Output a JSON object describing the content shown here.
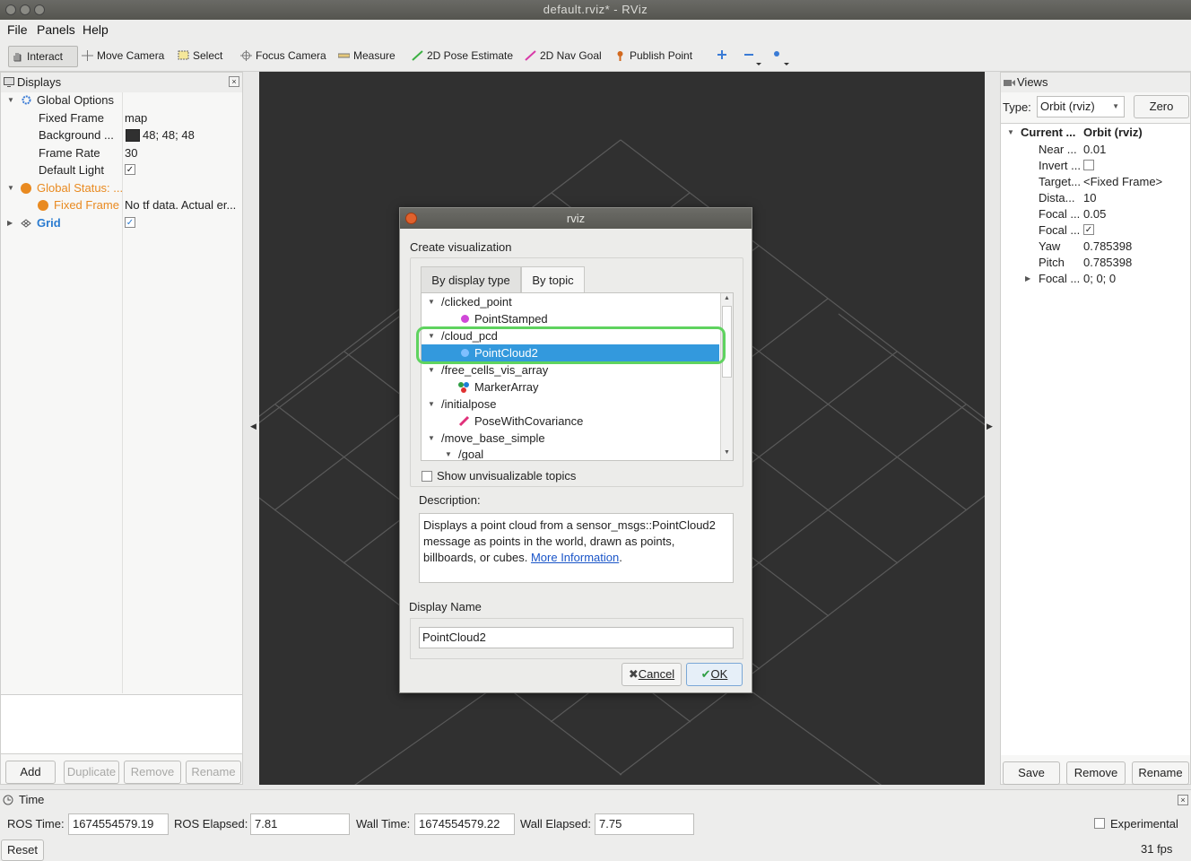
{
  "window": {
    "title": "default.rviz* - RViz"
  },
  "menu": {
    "file": "File",
    "panels": "Panels",
    "help": "Help"
  },
  "toolbar": {
    "interact": "Interact",
    "move_camera": "Move Camera",
    "select": "Select",
    "focus_camera": "Focus Camera",
    "measure": "Measure",
    "pose_estimate": "2D Pose Estimate",
    "nav_goal": "2D Nav Goal",
    "publish_point": "Publish Point"
  },
  "displays": {
    "title": "Displays",
    "global_options": "Global Options",
    "fixed_frame_label": "Fixed Frame",
    "fixed_frame_value": "map",
    "background_label": "Background ...",
    "background_value": "48; 48; 48",
    "frame_rate_label": "Frame Rate",
    "frame_rate_value": "30",
    "default_light_label": "Default Light",
    "global_status": "Global Status: ...",
    "fixed_frame_status_label": "Fixed Frame",
    "fixed_frame_status_value": "No tf data.  Actual er...",
    "grid_label": "Grid",
    "buttons": {
      "add": "Add",
      "duplicate": "Duplicate",
      "remove": "Remove",
      "rename": "Rename"
    }
  },
  "views": {
    "title": "Views",
    "type_label": "Type:",
    "type_value": "Orbit (rviz)",
    "zero": "Zero",
    "current_label": "Current ...",
    "current_value": "Orbit (rviz)",
    "props": [
      {
        "label": "Near ...",
        "value": "0.01"
      },
      {
        "label": "Invert ...",
        "value": ""
      },
      {
        "label": "Target...",
        "value": "<Fixed Frame>"
      },
      {
        "label": "Dista...",
        "value": "10"
      },
      {
        "label": "Focal ...",
        "value": "0.05"
      },
      {
        "label": "Focal ...",
        "value": ""
      },
      {
        "label": "Yaw",
        "value": "0.785398"
      },
      {
        "label": "Pitch",
        "value": "0.785398"
      },
      {
        "label": "Focal ...",
        "value": "0; 0; 0"
      }
    ],
    "buttons": {
      "save": "Save",
      "remove": "Remove",
      "rename": "Rename"
    }
  },
  "dialog": {
    "title": "rviz",
    "heading": "Create visualization",
    "tab_display_type": "By display type",
    "tab_topic": "By topic",
    "topics": [
      {
        "text": "/clicked_point",
        "kind": "topic"
      },
      {
        "text": "PointStamped",
        "kind": "type"
      },
      {
        "text": "/cloud_pcd",
        "kind": "topic"
      },
      {
        "text": "PointCloud2",
        "kind": "type"
      },
      {
        "text": "/free_cells_vis_array",
        "kind": "topic"
      },
      {
        "text": "MarkerArray",
        "kind": "type"
      },
      {
        "text": "/initialpose",
        "kind": "topic"
      },
      {
        "text": "PoseWithCovariance",
        "kind": "type"
      },
      {
        "text": "/move_base_simple",
        "kind": "topic"
      },
      {
        "text": "/goal",
        "kind": "topic"
      }
    ],
    "selected": "PointCloud2",
    "show_unvisualizable": "Show unvisualizable topics",
    "description_label": "Description:",
    "description_text": "Displays a point cloud from a sensor_msgs::PointCloud2 message as points in the world, drawn as points, billboards, or cubes.",
    "more_info": "More Information",
    "display_name_label": "Display Name",
    "display_name_value": "PointCloud2",
    "cancel": "Cancel",
    "ok": "OK",
    "highlight_color": "#5fd35f"
  },
  "time": {
    "title": "Time",
    "ros_time_label": "ROS Time:",
    "ros_time_value": "1674554579.19",
    "ros_elapsed_label": "ROS Elapsed:",
    "ros_elapsed_value": "7.81",
    "wall_time_label": "Wall Time:",
    "wall_time_value": "1674554579.22",
    "wall_elapsed_label": "Wall Elapsed:",
    "wall_elapsed_value": "7.75",
    "experimental": "Experimental",
    "fps": "31 fps",
    "reset": "Reset"
  },
  "colors": {
    "viewport_bg": "#303030",
    "selection": "#3399dd",
    "status_orange": "#e98a20",
    "grid_blue": "#2a7bd0"
  }
}
